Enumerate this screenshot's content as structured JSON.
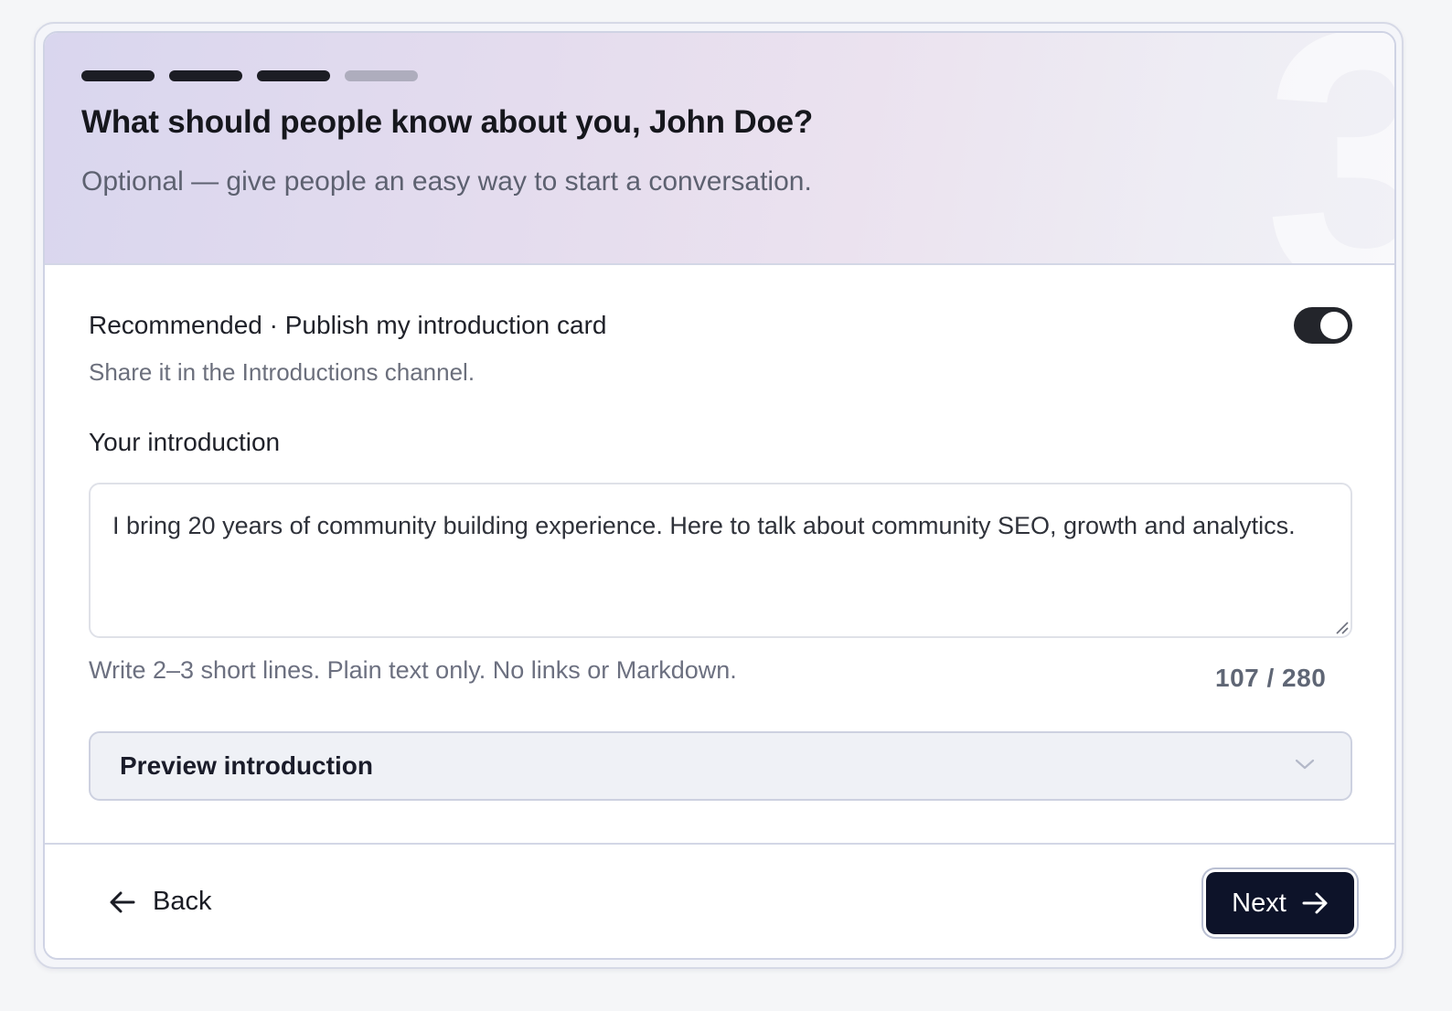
{
  "header": {
    "step_number": "3",
    "progress": {
      "current_step": 3,
      "total_steps": 4
    },
    "title": "What should people know about you, John Doe?",
    "subtitle": "Optional — give people an easy way to start a conversation."
  },
  "publish": {
    "label": "Recommended · Publish my introduction card",
    "description": "Share it in the Introductions channel.",
    "enabled": true
  },
  "intro": {
    "label": "Your introduction",
    "value": "I bring 20 years of community building experience. Here to talk about community SEO, growth and analytics.",
    "hint": "Write 2–3 short lines. Plain text only. No links or Markdown.",
    "counter": "107 / 280"
  },
  "preview": {
    "label": "Preview introduction",
    "icon": "chevron-down-icon"
  },
  "footer": {
    "back_label": "Back",
    "back_icon": "arrow-left-icon",
    "next_label": "Next",
    "next_icon": "arrow-right-icon"
  },
  "colors": {
    "primary_button": "#0d1329",
    "toggle_on": "#23252b",
    "progress_active": "#1c1d24",
    "progress_inactive": "#aeadbd"
  }
}
